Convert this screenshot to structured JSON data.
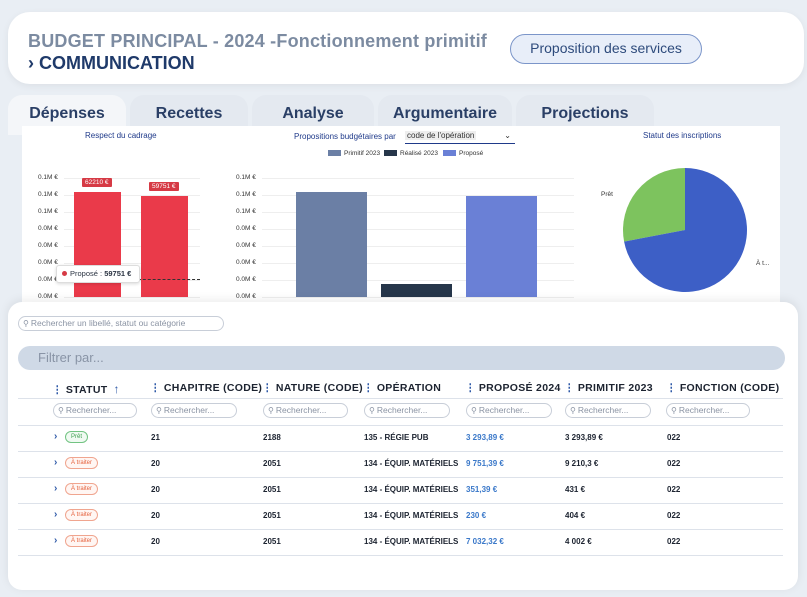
{
  "header": {
    "title": "BUDGET PRINCIPAL - 2024 -Fonctionnement primitif",
    "subtitle": "› COMMUNICATION",
    "proposition_button": "Proposition des services"
  },
  "tabs": [
    "Dépenses",
    "Recettes",
    "Analyse",
    "Argumentaire",
    "Projections"
  ],
  "colors": {
    "cadrage_bar": "#ea3a4a",
    "primitif": "#6b7fa5",
    "realise": "#26364a",
    "propose": "#6a80d6",
    "pie_pret": "#7dc35e",
    "pie_a_traiter": "#3d5fc6"
  },
  "charts": {
    "cadrage_title": "Respect du cadrage",
    "propositions_title": "Propositions budgétaires par",
    "select_value": "code de l'opération",
    "statut_title": "Statut des inscriptions",
    "y_ticks": [
      "0.1M €",
      "0.1M €",
      "0.1M €",
      "0.0M €",
      "0.0M €",
      "0.0M €",
      "0.0M €",
      "0.0M €"
    ],
    "tooltip_label": "Proposé",
    "tooltip_value": "59751 €",
    "pie_label_pret": "Prêt",
    "pie_label_traiter": "À t..."
  },
  "chart_data": [
    {
      "type": "bar",
      "title": "Respect du cadrage",
      "categories": [
        "",
        ""
      ],
      "values": [
        62210,
        59751
      ],
      "data_labels": [
        "62210 €",
        "59751 €"
      ]
    },
    {
      "type": "bar",
      "title": "Propositions budgétaires par code de l'opération",
      "categories": [
        "Primitif 2023",
        "Réalisé 2023",
        "Proposé"
      ],
      "series": [
        {
          "name": "Primitif 2023",
          "values": [
            62200
          ]
        },
        {
          "name": "Réalisé 2023",
          "values": [
            7500
          ]
        },
        {
          "name": "Proposé",
          "values": [
            59751
          ]
        }
      ]
    },
    {
      "type": "pie",
      "title": "Statut des inscriptions",
      "categories": [
        "Prêt",
        "À t..."
      ],
      "values": [
        28,
        72
      ]
    }
  ],
  "table": {
    "search_placeholder": "Rechercher un libellé, statut ou catégorie",
    "filter_placeholder": "Filtrer par...",
    "column_search_placeholder": "Rechercher...",
    "columns": [
      "STATUT",
      "CHAPITRE (CODE)",
      "NATURE (CODE)",
      "OPÉRATION",
      "PROPOSÉ 2024",
      "PRIMITIF 2023",
      "FONCTION (CODE)"
    ],
    "rows": [
      {
        "statut": "Prêt",
        "chapitre": "21",
        "nature": "2188",
        "operation": "135 - RÉGIE PUB",
        "propose": "3 293,89 €",
        "primitif": "3 293,89 €",
        "fonction": "022"
      },
      {
        "statut": "À traiter",
        "chapitre": "20",
        "nature": "2051",
        "operation": "134 - ÉQUIP. MATÉRIELS",
        "propose": "9 751,39 €",
        "primitif": "9 210,3 €",
        "fonction": "022"
      },
      {
        "statut": "À traiter",
        "chapitre": "20",
        "nature": "2051",
        "operation": "134 - ÉQUIP. MATÉRIELS",
        "propose": "351,39 €",
        "primitif": "431 €",
        "fonction": "022"
      },
      {
        "statut": "À traiter",
        "chapitre": "20",
        "nature": "2051",
        "operation": "134 - ÉQUIP. MATÉRIELS",
        "propose": "230 €",
        "primitif": "404 €",
        "fonction": "022"
      },
      {
        "statut": "À traiter",
        "chapitre": "20",
        "nature": "2051",
        "operation": "134 - ÉQUIP. MATÉRIELS",
        "propose": "7 032,32 €",
        "primitif": "4 002 €",
        "fonction": "022"
      }
    ]
  }
}
